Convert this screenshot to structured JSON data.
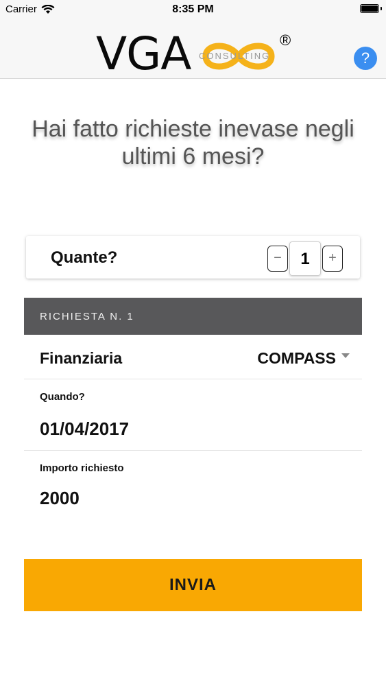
{
  "status": {
    "carrier": "Carrier",
    "time": "8:35 PM"
  },
  "header": {
    "logo": {
      "text": "VGA",
      "subtext": "CONSULTING",
      "registered": "®"
    },
    "help_label": "?"
  },
  "question": "Hai fatto richieste inevase negli ultimi 6 mesi?",
  "quantity": {
    "label": "Quante?",
    "decrement": "−",
    "value": "1",
    "increment": "+"
  },
  "request": {
    "section_title": "RICHIESTA N. 1",
    "finanziaria_label": "Finanziaria",
    "finanziaria_value": "COMPASS",
    "when_label": "Quando?",
    "when_value": "01/04/2017",
    "amount_label": "Importo richiesto",
    "amount_value": "2000"
  },
  "submit_label": "INVIA",
  "colors": {
    "accent": "#f9a803",
    "section_header": "#58585a",
    "help_button": "#3b8ef0",
    "logo_infinity": "#f5b21a"
  }
}
